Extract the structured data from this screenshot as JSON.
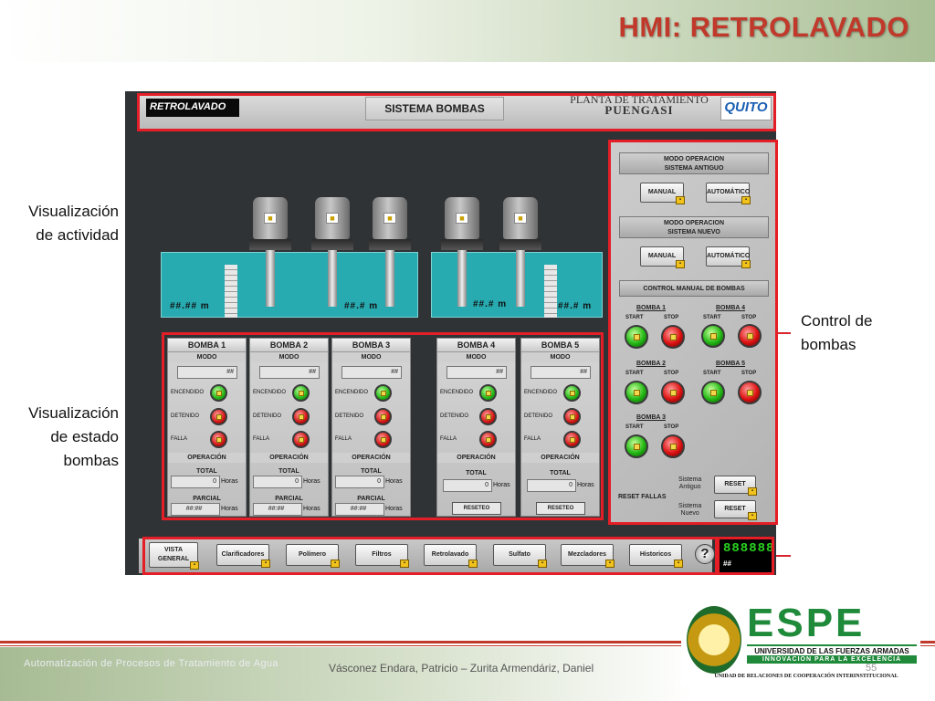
{
  "slide": {
    "title": "HMI: RETROLAVADO",
    "labels": {
      "activity": [
        "Visualización",
        "de actividad"
      ],
      "pump_status": [
        "Visualización",
        "de estado",
        "bombas"
      ],
      "pump_control": [
        "Control de",
        "bombas"
      ]
    },
    "footer": {
      "course": "Automatización de Procesos de Tratamiento de Agua",
      "authors": "Vásconez Endara, Patricio – Zurita Armendáriz, Daniel",
      "page": "55"
    },
    "espe_logo": {
      "word": "ESPE",
      "line1": "UNIVERSIDAD DE LAS FUERZAS ARMADAS",
      "line2": "INNOVACIÓN PARA LA EXCELENCIA",
      "line3": "UNIDAD DE RELACIONES DE COOPERACIÓN INTERINSTITUCIONAL"
    }
  },
  "hmi": {
    "header": {
      "mode": "RETROLAVADO",
      "system": "SISTEMA BOMBAS",
      "plant_line1": "PLANTA DE TRATAMIENTO",
      "plant_line2": "PUENGASI",
      "logo": "QUITO"
    },
    "tanks": [
      {
        "level": "##.## m",
        "level2": "##.# m"
      },
      {
        "level": "##.# m",
        "level2": "##.# m"
      }
    ],
    "status_labels": {
      "mode": "MODO",
      "on": "ENCENDIDO",
      "stopped": "DETENIDO",
      "fault": "FALLA",
      "operation": "OPERACIÓN",
      "total": "TOTAL",
      "partial": "PARCIAL",
      "hours": "Horas",
      "reset": "RESETEO"
    },
    "pumps": [
      {
        "name": "BOMBA 1",
        "mode_value": "##",
        "total": "0",
        "partial": "##:##"
      },
      {
        "name": "BOMBA 2",
        "mode_value": "##",
        "total": "0",
        "partial": "##:##"
      },
      {
        "name": "BOMBA 3",
        "mode_value": "##",
        "total": "0",
        "partial": "##:##"
      },
      {
        "name": "BOMBA 4",
        "mode_value": "##",
        "total": "0"
      },
      {
        "name": "BOMBA 5",
        "mode_value": "##",
        "total": "0"
      }
    ],
    "control": {
      "old_mode_title": [
        "MODO OPERACION",
        "SISTEMA ANTIGUO"
      ],
      "new_mode_title": [
        "MODO OPERACION",
        "SISTEMA NUEVO"
      ],
      "manual": "MANUAL",
      "auto": "AUTOMÁTICO",
      "manual_control_title": "CONTROL MANUAL DE BOMBAS",
      "start": "START",
      "stop": "STOP",
      "pumps": [
        "BOMBA 1",
        "BOMBA 4",
        "BOMBA 2",
        "BOMBA 5",
        "BOMBA 3"
      ],
      "reset_faults": "RESET FALLAS",
      "old_system": [
        "Sistema",
        "Antiguo"
      ],
      "new_system": [
        "Sistema",
        "Nuevo"
      ],
      "reset": "RESET"
    },
    "nav": {
      "overview": [
        "VISTA",
        "GENERAL"
      ],
      "buttons": [
        "Clarificadores",
        "Polímero",
        "Filtros",
        "Retrolavado",
        "Sulfato",
        "Mezcladores",
        "Historicos"
      ],
      "help": "?",
      "display_digits": "888888",
      "display_value": "##"
    },
    "colors": {
      "accent_red": "#e41e26",
      "tank": "#27aab0",
      "led_green": "#23b814",
      "led_red": "#d11111",
      "title_red": "#c0392b",
      "espe_green": "#1f8a3a"
    }
  }
}
